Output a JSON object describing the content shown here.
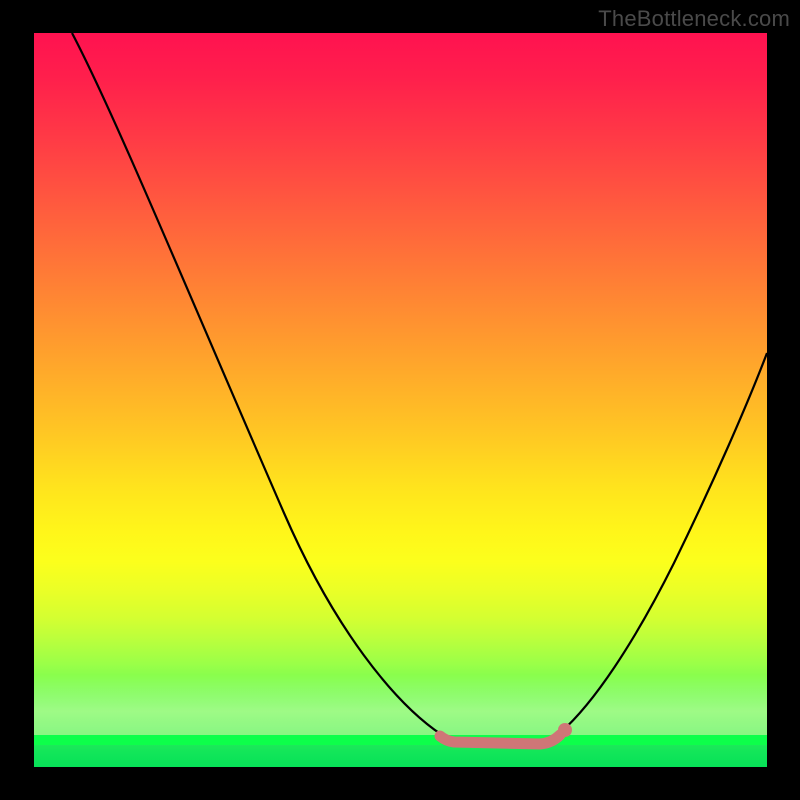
{
  "watermark": "TheBottleneck.com",
  "chart_data": {
    "type": "line",
    "title": "",
    "xlabel": "",
    "ylabel": "",
    "xlim": [
      0,
      100
    ],
    "ylim": [
      0,
      100
    ],
    "series": [
      {
        "name": "bottleneck-curve",
        "x": [
          0,
          6,
          12,
          18,
          24,
          30,
          36,
          42,
          48,
          54,
          58,
          62,
          65,
          68,
          72,
          76,
          80,
          84,
          88,
          92,
          96,
          100
        ],
        "y": [
          100,
          90,
          80,
          70,
          60,
          50,
          40,
          30,
          20,
          11,
          6,
          3,
          2,
          2,
          3,
          7,
          14,
          22,
          31,
          40,
          49,
          58
        ]
      }
    ],
    "marker_flat_segment": {
      "x_start": 56,
      "x_end": 72,
      "y": 3
    },
    "marker_dot": {
      "x": 72,
      "y": 4
    },
    "colors": {
      "curve": "#000000",
      "flat_segment": "#cf7677",
      "dot": "#cf7677",
      "background_top": "#ff1250",
      "background_bottom": "#07e158"
    }
  }
}
